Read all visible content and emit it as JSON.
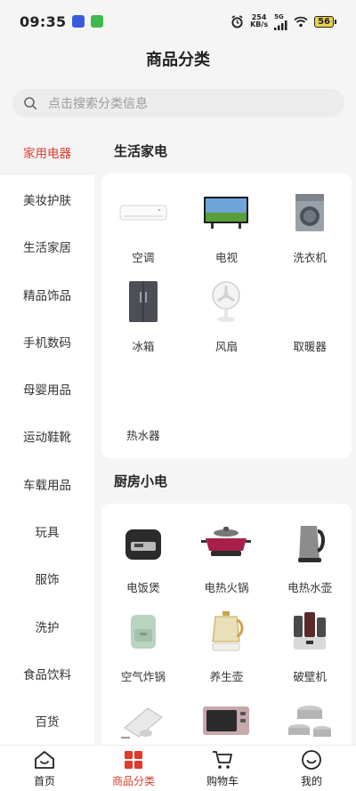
{
  "status_bar": {
    "time": "09:35",
    "speed_value": "254",
    "speed_unit": "KB/s",
    "network": "5G",
    "battery": "56"
  },
  "header": {
    "title": "商品分类"
  },
  "search": {
    "placeholder": "点击搜索分类信息",
    "icon": "search-icon"
  },
  "colors": {
    "accent": "#e03a2a",
    "background": "#f5f5f5",
    "card": "#ffffff"
  },
  "sidebar": {
    "items": [
      {
        "label": "家用电器",
        "active": true
      },
      {
        "label": "美妆护肤"
      },
      {
        "label": "生活家居"
      },
      {
        "label": "精品饰品"
      },
      {
        "label": "手机数码"
      },
      {
        "label": "母婴用品"
      },
      {
        "label": "运动鞋靴"
      },
      {
        "label": "车载用品"
      },
      {
        "label": "玩具"
      },
      {
        "label": "服饰"
      },
      {
        "label": "洗护"
      },
      {
        "label": "食品饮料"
      },
      {
        "label": "百货"
      }
    ]
  },
  "sections": [
    {
      "title": "生活家电",
      "items": [
        {
          "label": "空调",
          "icon": "air-conditioner-icon"
        },
        {
          "label": "电视",
          "icon": "tv-icon"
        },
        {
          "label": "洗衣机",
          "icon": "washing-machine-icon"
        },
        {
          "label": "冰箱",
          "icon": "fridge-icon"
        },
        {
          "label": "风扇",
          "icon": "fan-icon"
        },
        {
          "label": "取暖器",
          "icon": ""
        },
        {
          "label": "热水器",
          "icon": ""
        }
      ]
    },
    {
      "title": "厨房小电",
      "items": [
        {
          "label": "电饭煲",
          "icon": "rice-cooker-icon"
        },
        {
          "label": "电热火锅",
          "icon": "hotpot-icon"
        },
        {
          "label": "电热水壶",
          "icon": "kettle-icon"
        },
        {
          "label": "空气炸锅",
          "icon": "air-fryer-icon"
        },
        {
          "label": "养生壶",
          "icon": "health-pot-icon"
        },
        {
          "label": "破壁机",
          "icon": "blender-icon"
        },
        {
          "label": "",
          "icon": "induction-cooker-icon"
        },
        {
          "label": "",
          "icon": "oven-icon"
        },
        {
          "label": "",
          "icon": "cookware-icon"
        }
      ]
    }
  ],
  "tabbar": {
    "items": [
      {
        "label": "首页",
        "icon": "home-icon"
      },
      {
        "label": "商品分类",
        "icon": "category-icon",
        "active": true
      },
      {
        "label": "购物车",
        "icon": "cart-icon"
      },
      {
        "label": "我的",
        "icon": "profile-icon"
      }
    ]
  }
}
